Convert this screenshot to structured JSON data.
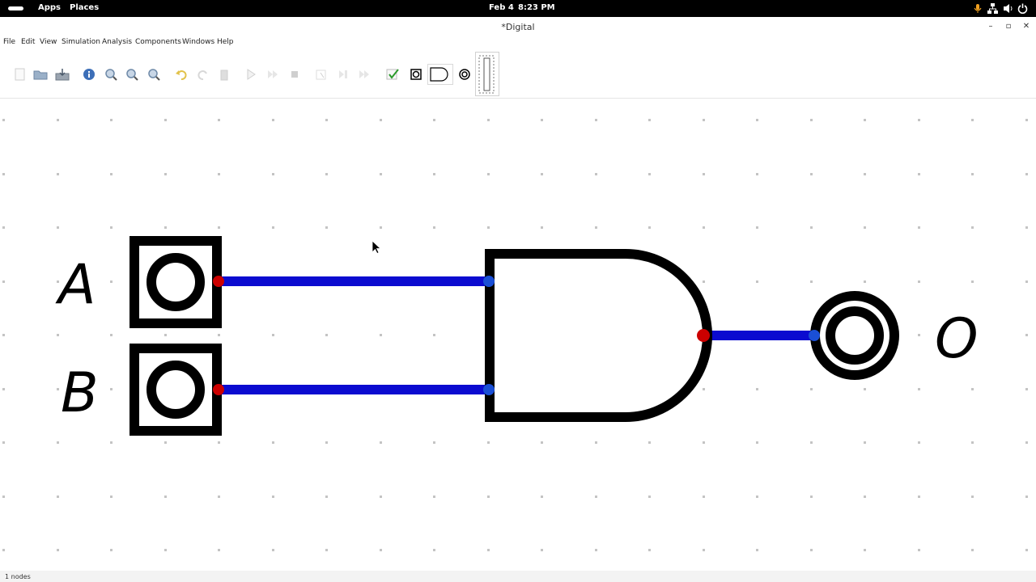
{
  "topbar": {
    "apps": "Apps",
    "places": "Places",
    "date": "Feb 4",
    "time": "8:23 PM"
  },
  "window": {
    "title": "*Digital"
  },
  "menu": {
    "file": "File",
    "edit": "Edit",
    "view": "View",
    "simulation": "Simulation",
    "analysis": "Analysis",
    "components": "Components",
    "windows": "Windows",
    "help": "Help"
  },
  "circuit": {
    "input_a": "A",
    "input_b": "B",
    "output_o": "O",
    "gate": "AND",
    "colors": {
      "wire": "#0b0bd0",
      "pin_out": "#cc0000",
      "pin_in": "#1a4fd6",
      "component": "#000000"
    }
  },
  "status": {
    "text": "1 nodes"
  }
}
